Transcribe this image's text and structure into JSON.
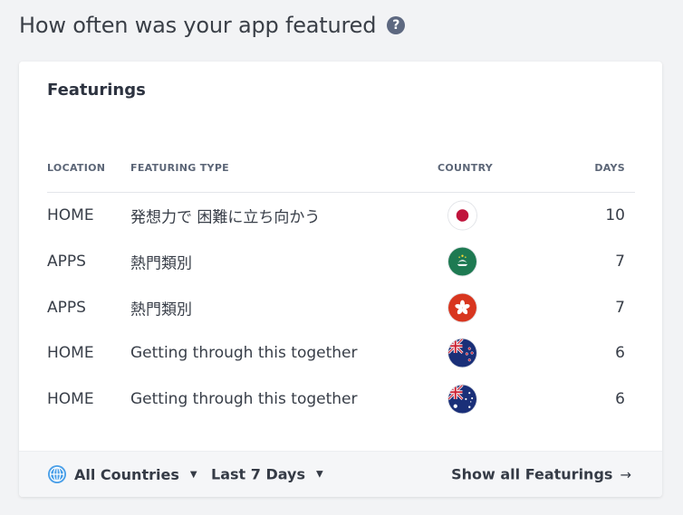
{
  "header": {
    "title": "How often was your app featured",
    "help_icon": "question-circle-icon"
  },
  "card": {
    "title": "Featurings",
    "columns": {
      "location": "LOCATION",
      "featuring_type": "FEATURING TYPE",
      "country": "COUNTRY",
      "days": "DAYS"
    },
    "rows": [
      {
        "location": "HOME",
        "featuring_type": "発想力で 困難に立ち向かう",
        "country_flag": "japan-flag-icon",
        "days": "10"
      },
      {
        "location": "APPS",
        "featuring_type": "熱門類別",
        "country_flag": "macau-flag-icon",
        "days": "7"
      },
      {
        "location": "APPS",
        "featuring_type": "熱門類別",
        "country_flag": "hong-kong-flag-icon",
        "days": "7"
      },
      {
        "location": "HOME",
        "featuring_type": "Getting through this together",
        "country_flag": "new-zealand-flag-icon",
        "days": "6"
      },
      {
        "location": "HOME",
        "featuring_type": "Getting through this together",
        "country_flag": "australia-flag-icon",
        "days": "6"
      }
    ],
    "footer": {
      "countries_filter": "All Countries",
      "period_filter": "Last 7 Days",
      "show_all": "Show all Featurings"
    }
  },
  "colors": {
    "background": "#f2f3f5",
    "card": "#ffffff",
    "footer": "#f5f6f8",
    "help_icon": "#5d6880",
    "globe_icon": "#4a9fe8"
  }
}
